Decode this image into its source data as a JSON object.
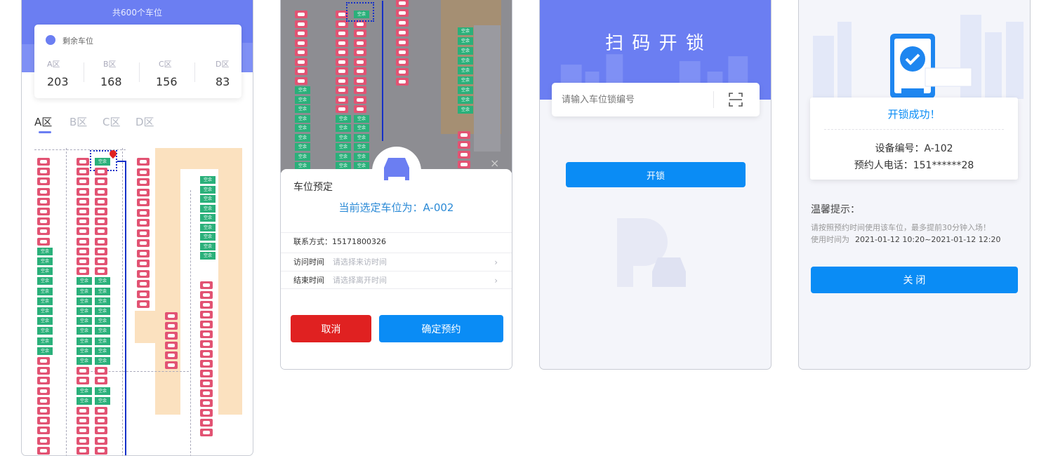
{
  "s1": {
    "total": "共600个车位",
    "legend": "剩余车位",
    "zones": [
      {
        "label": "A区",
        "value": "203"
      },
      {
        "label": "B区",
        "value": "168"
      },
      {
        "label": "C区",
        "value": "156"
      },
      {
        "label": "D区",
        "value": "83"
      }
    ],
    "tabs": [
      "A区",
      "B区",
      "C区",
      "D区"
    ],
    "free_label": "空余"
  },
  "s2": {
    "title": "车位预定",
    "selected": "当前选定车位为：A-002",
    "contact": "联系方式：15171800326",
    "visit_label": "访问时间",
    "visit_ph": "请选择来访时间",
    "leave_label": "结束时间",
    "leave_ph": "请选择离开时间",
    "cancel": "取消",
    "confirm": "确定预约"
  },
  "s3": {
    "title": "扫 码 开 锁",
    "placeholder": "请输入车位锁编号",
    "unlock": "开锁"
  },
  "s4": {
    "success": "开锁成功！",
    "device": "设备编号：A-102",
    "phone": "预约人电话：151******28",
    "tip_title": "温馨提示：",
    "tip1": "请按照预约时间使用该车位，最多提前30分钟入场！",
    "tip2_label": "使用时间为",
    "tip2_value": "2021-01-12 10:20~2021-01-12 12:20",
    "close": "关 闭"
  },
  "colors": {
    "header": "#6b7ef2",
    "primary": "#0a8cf5",
    "danger": "#e02121",
    "free": "#2ab07a",
    "occupied": "#e25373",
    "route": "#1530c8"
  }
}
